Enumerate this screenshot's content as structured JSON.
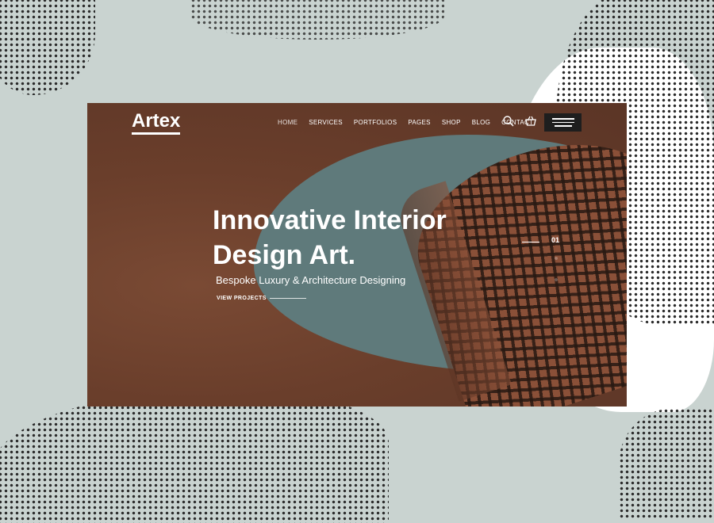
{
  "brand": {
    "logo": "Artex"
  },
  "nav": {
    "items": [
      "HOME",
      "SERVICES",
      "PORTFOLIOS",
      "PAGES",
      "SHOP",
      "BLOG",
      "CONTACT"
    ],
    "active": "HOME"
  },
  "hero": {
    "title_line1": "Innovative Interior",
    "title_line2": "Design Art.",
    "subtitle": "Bespoke Luxury & Architecture Designing",
    "cta_label": "VIEW PROJECTS",
    "slide_number": "01",
    "bg_color": "#6a3e2b",
    "accent_color": "#5f7a7b"
  },
  "icons": {
    "search": "search-icon",
    "cart": "cart-icon",
    "menu": "hamburger-menu-icon"
  }
}
